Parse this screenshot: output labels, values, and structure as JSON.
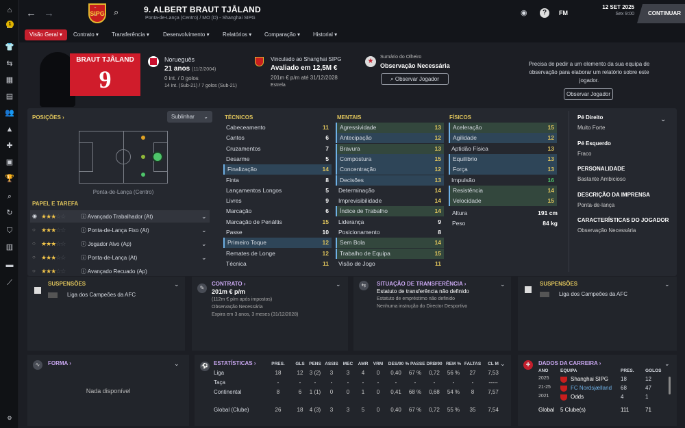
{
  "colors": {
    "accent": "#c41f2d",
    "yellow": "#e0c55c",
    "green": "#4ec56a",
    "purple": "#c9a7f0"
  },
  "header": {
    "number_name": "9. ALBERT BRAUT TJÅLAND",
    "subtitle": "Ponta-de-Lança (Centro) / MO (D) - Shanghai SIPG",
    "date": "12 SET 2025",
    "weekday_time": "Sex 9:00",
    "continue": "CONTINUAR",
    "fm": "FM",
    "badge": "1",
    "crest": "SIPG"
  },
  "tabs": [
    "Visão Geral",
    "Contrato",
    "Transferência",
    "Desenvolvimento",
    "Relatórios",
    "Comparação",
    "Historial"
  ],
  "profile": {
    "shirt_name": "BRAUT TJÅLAND",
    "shirt_number": "9",
    "nationality": "Norueguês",
    "age": "21 anos",
    "dob": "(11/2/2004)",
    "caps": "0 int. / 0 golos",
    "youth_caps": "14 int. (Sub-21) / 7 golos (Sub-21)",
    "club_line": "Vinculado ao Shanghai SIPG",
    "value": "Avaliado em 12,5M €",
    "wage": "201m € p/m até 31/12/2028",
    "status": "Estrela",
    "scout_title": "Sumário do Olheiro",
    "scout_value": "Observação Necessária",
    "scout_btn": "Observar Jogador",
    "scout_request": "Precisa de pedir a um elemento da sua equipa de observação para elaborar um relatório sobre este jogador.",
    "scout_btn2": "Observar Jogador"
  },
  "positions": {
    "title": "POSIÇÕES",
    "dropdown": "Sublinhar",
    "pos_label": "Ponta-de-Lança (Centro)",
    "roles_title": "PAPEL E TAREFA",
    "roles": [
      {
        "stars": "★★★",
        "empty": "☆☆",
        "name": "Avançado Trabalhador (At)"
      },
      {
        "stars": "★★★",
        "empty": "☆☆",
        "name": "Ponta-de-Lança Fixo (At)"
      },
      {
        "stars": "★★★",
        "empty": "☆☆",
        "name": "Jogador Alvo (Ap)"
      },
      {
        "stars": "★★★",
        "empty": "☆☆",
        "name": "Ponta-de-Lança (At)"
      },
      {
        "stars": "★★★",
        "empty": "☆☆",
        "name": "Avançado Recuado (Ap)"
      }
    ]
  },
  "attributes": {
    "tecnicos_title": "TÉCNICOS",
    "mentais_title": "MENTAIS",
    "fisicos_title": "FÍSICOS",
    "tecnicos": [
      [
        "Cabeceamento",
        "11",
        ""
      ],
      [
        "Cantos",
        "6",
        ""
      ],
      [
        "Cruzamentos",
        "7",
        ""
      ],
      [
        "Desarme",
        "5",
        ""
      ],
      [
        "Finalização",
        "14",
        "b"
      ],
      [
        "Finta",
        "8",
        ""
      ],
      [
        "Lançamentos Longos",
        "5",
        ""
      ],
      [
        "Livres",
        "9",
        ""
      ],
      [
        "Marcação",
        "6",
        ""
      ],
      [
        "Marcação de Penáltis",
        "15",
        ""
      ],
      [
        "Passe",
        "10",
        ""
      ],
      [
        "Primeiro Toque",
        "12",
        "b"
      ],
      [
        "Remates de Longe",
        "12",
        ""
      ],
      [
        "Técnica",
        "11",
        ""
      ]
    ],
    "mentais": [
      [
        "Agressividade",
        "13",
        "g"
      ],
      [
        "Antecipação",
        "12",
        "b"
      ],
      [
        "Bravura",
        "13",
        "g"
      ],
      [
        "Compostura",
        "15",
        "b"
      ],
      [
        "Concentração",
        "12",
        "b"
      ],
      [
        "Decisões",
        "13",
        "b"
      ],
      [
        "Determinação",
        "14",
        ""
      ],
      [
        "Imprevisibilidade",
        "14",
        ""
      ],
      [
        "Índice de Trabalho",
        "14",
        "g"
      ],
      [
        "Liderança",
        "9",
        ""
      ],
      [
        "Posicionamento",
        "8",
        ""
      ],
      [
        "Sem Bola",
        "14",
        "g"
      ],
      [
        "Trabalho de Equipa",
        "15",
        "g"
      ],
      [
        "Visão de Jogo",
        "11",
        ""
      ]
    ],
    "fisicos": [
      [
        "Aceleração",
        "15",
        "g"
      ],
      [
        "Agilidade",
        "12",
        "b"
      ],
      [
        "Aptidão Física",
        "13",
        ""
      ],
      [
        "Equilíbrio",
        "13",
        "b"
      ],
      [
        "Força",
        "13",
        "b"
      ],
      [
        "Impulsão",
        "16",
        ""
      ],
      [
        "Resistência",
        "14",
        "g"
      ],
      [
        "Velocidade",
        "15",
        "g"
      ]
    ],
    "altura_label": "Altura",
    "altura": "191 cm",
    "peso_label": "Peso",
    "peso": "84 kg"
  },
  "side_info": [
    {
      "t": "Pé Direito",
      "v": "Muito Forte"
    },
    {
      "t": "Pé Esquerdo",
      "v": "Fraco"
    },
    {
      "t": "PERSONALIDADE",
      "v": "Bastante Ambicioso"
    },
    {
      "t": "DESCRIÇÃO DA IMPRENSA",
      "v": "Ponta-de-lança"
    },
    {
      "t": "CARACTERÍSTICAS DO JOGADOR",
      "v": "Observação Necessária"
    }
  ],
  "cards": {
    "susp1_title": "SUSPENSÕES",
    "susp1_text": "Liga dos Campeões da AFC",
    "contrato_title": "CONTRATO",
    "contrato_wage": "201m € p/m",
    "contrato_l1": "(112m € p/m após impostos)",
    "contrato_l2": "Observação Necessária",
    "contrato_l3": "Expira em 3 anos, 3 meses  (31/12/2028)",
    "transf_title": "SITUAÇÃO DE TRANSFERÊNCIA",
    "transf_l1": "Estatuto de transferência não definido",
    "transf_l2": "Estatuto de empréstimo não definido",
    "transf_l3": "Nenhuma instrução do Director Desportivo",
    "susp2_title": "SUSPENSÕES",
    "susp2_text": "Liga dos Campeões da AFC"
  },
  "forma": {
    "title": "FORMA",
    "empty": "Nada disponível"
  },
  "stats": {
    "title": "ESTATÍSTICAS",
    "headers": [
      "PRES.",
      "GLS",
      "PENS",
      "ASSIS",
      "MEC",
      "AMR",
      "VRM",
      "DES/90",
      "% PASSE",
      "DRB/90",
      "REM %",
      "FALTAS",
      "CL M"
    ],
    "rows": [
      {
        "name": "Liga",
        "vals": [
          "18",
          "12",
          "3 (2)",
          "3",
          "3",
          "4",
          "0",
          "0,40",
          "67 %",
          "0,72",
          "56 %",
          "27",
          "7,53"
        ]
      },
      {
        "name": "Taça",
        "vals": [
          "-",
          "-",
          "-",
          "-",
          "-",
          "-",
          "-",
          "-",
          "-",
          "-",
          "-",
          "-",
          "-----"
        ]
      },
      {
        "name": "Continental",
        "vals": [
          "8",
          "6",
          "1 (1)",
          "0",
          "0",
          "1",
          "0",
          "0,41",
          "68 %",
          "0,68",
          "54 %",
          "8",
          "7,57"
        ]
      },
      {
        "name": "Global (Clube)",
        "vals": [
          "26",
          "18",
          "4 (3)",
          "3",
          "3",
          "5",
          "0",
          "0,40",
          "67 %",
          "0,72",
          "55 %",
          "35",
          "7,54"
        ]
      }
    ]
  },
  "career": {
    "title": "DADOS DA CARREIRA",
    "headers": [
      "ANO",
      "EQUIPA",
      "PRES.",
      "GOLOS"
    ],
    "rows": [
      {
        "ano": "2025",
        "equipa": "Shanghai SIPG",
        "pres": "18",
        "golos": "12"
      },
      {
        "ano": "21-25",
        "equipa": "FC Nordsjælland",
        "pres": "68",
        "golos": "47"
      },
      {
        "ano": "2021",
        "equipa": "Odds",
        "pres": "4",
        "golos": "1"
      }
    ],
    "global_label": "Global",
    "global_team": "5 Clube(s)",
    "global_pres": "111",
    "global_golos": "71"
  }
}
